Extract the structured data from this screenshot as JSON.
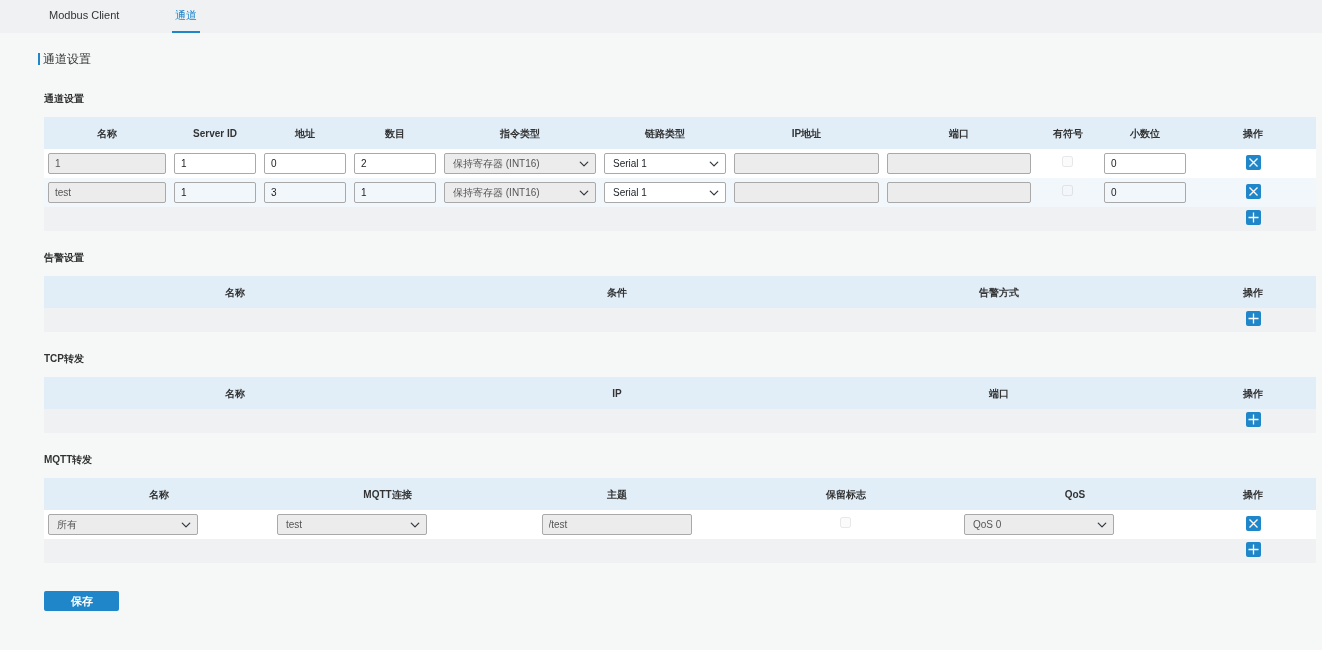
{
  "tabs": [
    {
      "label": "Modbus Client",
      "selected": false
    },
    {
      "label": "通道",
      "selected": true
    }
  ],
  "page_title": "通道设置",
  "sections": [
    {
      "title": "通道设置",
      "columns": [
        "名称",
        "Server ID",
        "地址",
        "数目",
        "指令类型",
        "链路类型",
        "IP地址",
        "端口",
        "有符号",
        "小数位",
        "操作"
      ],
      "rows": [
        [
          {
            "kind": "input",
            "value": "1",
            "disabled": true
          },
          {
            "kind": "input",
            "value": "1",
            "disabled": false
          },
          {
            "kind": "input",
            "value": "0",
            "disabled": false
          },
          {
            "kind": "input",
            "value": "2",
            "disabled": false
          },
          {
            "kind": "select",
            "value": "保持寄存器 (INT16)",
            "disabled": true
          },
          {
            "kind": "select",
            "value": "Serial 1",
            "disabled": false
          },
          {
            "kind": "input",
            "disabled": true
          },
          {
            "kind": "input",
            "disabled": true
          },
          {
            "kind": "checkbox",
            "checked": false,
            "disabled": true
          },
          {
            "kind": "input",
            "value": "0",
            "disabled": false
          },
          {
            "kind": "delete"
          }
        ],
        [
          {
            "kind": "input",
            "value": "test",
            "disabled": true
          },
          {
            "kind": "input",
            "value": "1",
            "disabled": false
          },
          {
            "kind": "input",
            "value": "3",
            "disabled": false
          },
          {
            "kind": "input",
            "value": "1",
            "disabled": false
          },
          {
            "kind": "select",
            "value": "保持寄存器 (INT16)",
            "disabled": true
          },
          {
            "kind": "select",
            "value": "Serial 1",
            "disabled": false
          },
          {
            "kind": "input",
            "disabled": true
          },
          {
            "kind": "input",
            "disabled": true
          },
          {
            "kind": "checkbox",
            "checked": false,
            "disabled": true
          },
          {
            "kind": "input",
            "value": "0",
            "disabled": false
          },
          {
            "kind": "delete"
          }
        ]
      ]
    },
    {
      "title": "告警设置",
      "columns": [
        "名称",
        "条件",
        "告警方式",
        "操作"
      ]
    },
    {
      "title": "TCP转发",
      "columns": [
        "名称",
        "IP",
        "端口",
        "操作"
      ]
    },
    {
      "title": "MQTT转发",
      "columns": [
        "名称",
        "MQTT连接",
        "主题",
        "保留标志",
        "QoS",
        "操作"
      ],
      "rows": [
        [
          {
            "kind": "select",
            "value": "所有",
            "disabled": true
          },
          {
            "kind": "select",
            "value": "test",
            "disabled": true
          },
          {
            "kind": "input",
            "value": "/test",
            "disabled": true
          },
          {
            "kind": "checkbox",
            "checked": false,
            "disabled": true
          },
          {
            "kind": "select",
            "value": "QoS 0",
            "disabled": true
          },
          {
            "kind": "delete"
          }
        ]
      ]
    }
  ],
  "save_button": "保存"
}
